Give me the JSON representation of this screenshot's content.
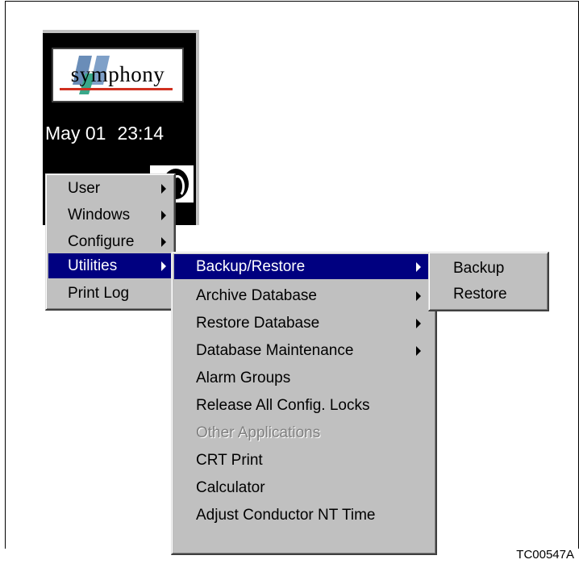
{
  "console": {
    "logo_text": "symphony",
    "date": "May 01",
    "time": "23:14"
  },
  "main_menu": {
    "items": [
      {
        "label": "User",
        "submenu": true
      },
      {
        "label": "Windows",
        "submenu": true
      },
      {
        "label": "Configure",
        "submenu": true
      },
      {
        "label": "Utilities",
        "submenu": true,
        "selected": true
      },
      {
        "label": "Print Log",
        "submenu": false
      }
    ]
  },
  "utilities_menu": {
    "items": [
      {
        "label": "Backup/Restore",
        "submenu": true,
        "selected": true
      },
      {
        "label": "Archive Database",
        "submenu": true
      },
      {
        "label": "Restore Database",
        "submenu": true
      },
      {
        "label": "Database Maintenance",
        "submenu": true
      },
      {
        "label": "Alarm Groups",
        "submenu": false
      },
      {
        "label": "Release All Config. Locks",
        "submenu": false
      },
      {
        "label": "Other Applications",
        "submenu": false,
        "disabled": true
      },
      {
        "label": "CRT Print",
        "submenu": false
      },
      {
        "label": "Calculator",
        "submenu": false
      },
      {
        "label": "Adjust Conductor NT Time",
        "submenu": false
      }
    ]
  },
  "backup_menu": {
    "items": [
      {
        "label": "Backup"
      },
      {
        "label": "Restore"
      }
    ]
  },
  "figure_code": "TC00547A",
  "colors": {
    "menu_bg": "#c0c0c0",
    "selection_bg": "#000080",
    "console_bg": "#000000"
  }
}
